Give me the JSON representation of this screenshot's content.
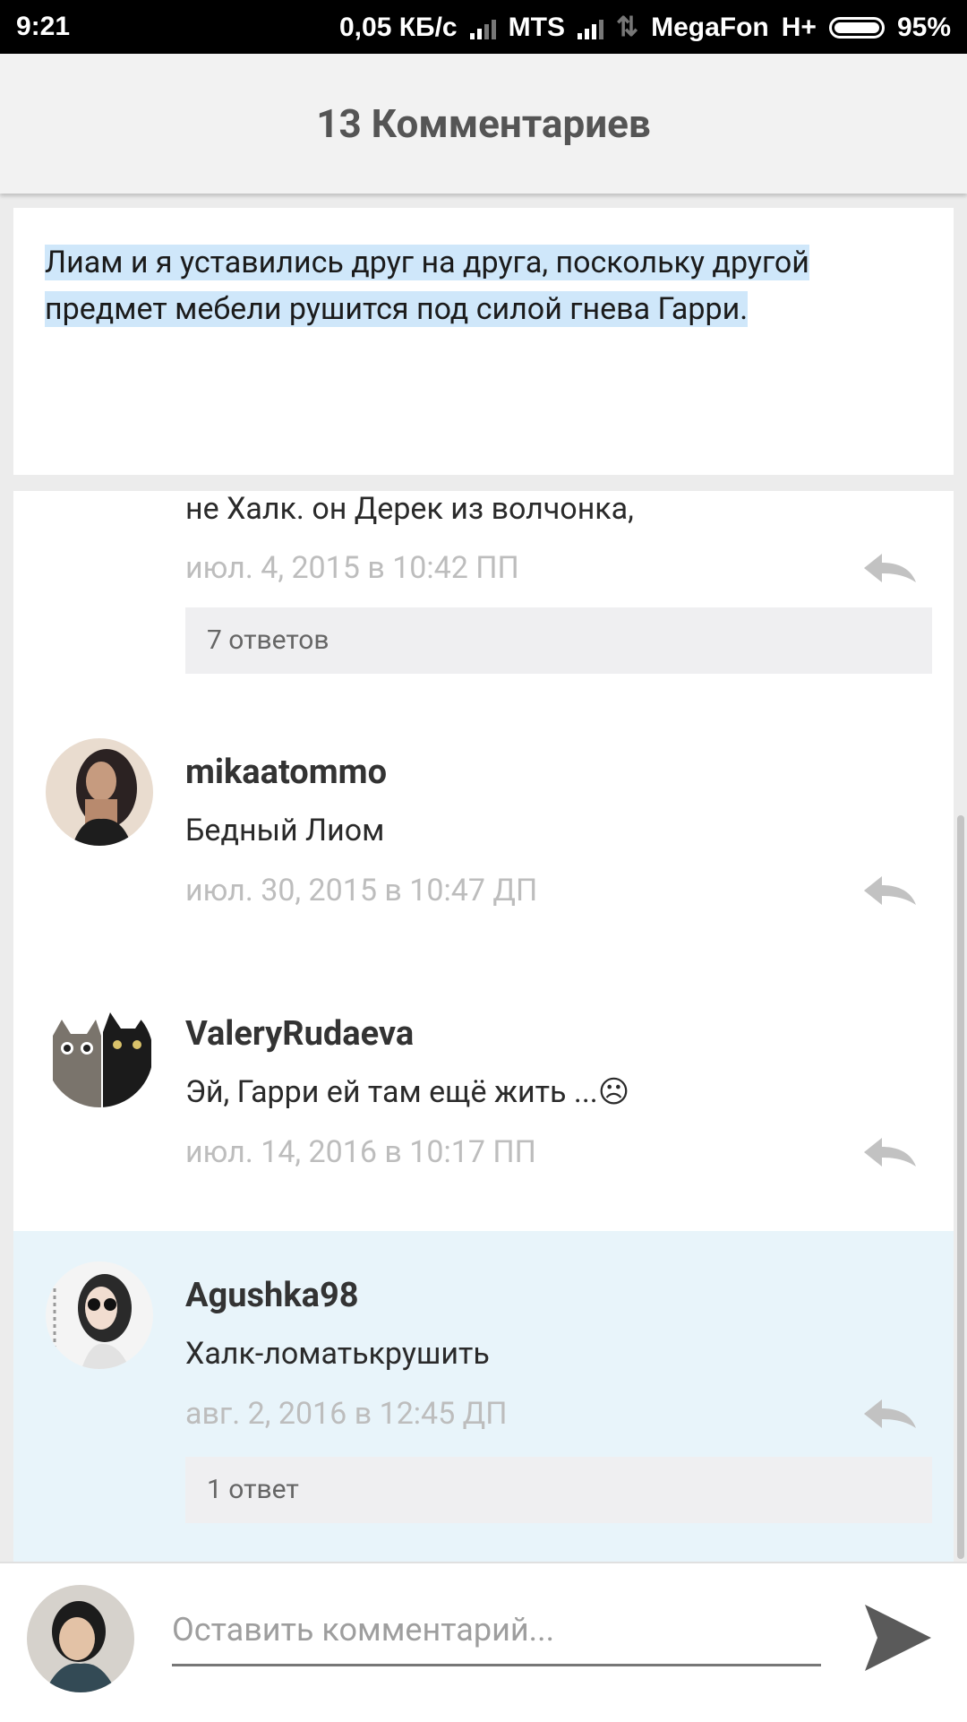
{
  "status_bar": {
    "time": "9:21",
    "speed": "0,05 КБ/с",
    "carrier1": "MTS",
    "carrier2": "MegaFon",
    "network": "H+",
    "battery": "95%"
  },
  "header": {
    "title": "13 Комментариев"
  },
  "quote": {
    "text": "Лиам и я уставились друг на друга, поскольку другой предмет мебели рушится под силой гнева Гарри."
  },
  "comments": [
    {
      "text": "не Халк. он Дерек из волчонка,",
      "date": "июл. 4, 2015 в 10:42 ПП",
      "replies": "7 ответов"
    },
    {
      "username": "mikaatommo",
      "text": "Бедный Лиом",
      "date": "июл. 30, 2015 в 10:47 ДП"
    },
    {
      "username": "ValeryRudaeva",
      "text": "Эй, Гарри ей там ещё жить ...☹",
      "date": "июл. 14, 2016 в 10:17 ПП"
    },
    {
      "username": "Agushka98",
      "text": "Халк-ломатькрушить",
      "date": "авг. 2, 2016 в 12:45 ДП",
      "replies": "1 ответ"
    }
  ],
  "footer": {
    "placeholder": "Оставить комментарий..."
  },
  "colors": {
    "highlight": "#cfe7fa",
    "selected_row": "#e8f4fa",
    "emoji": "#f4b400"
  }
}
